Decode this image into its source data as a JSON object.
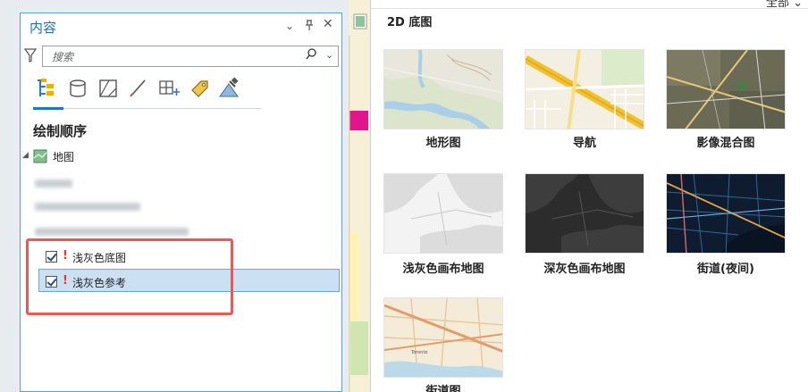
{
  "contents": {
    "title": "内容",
    "header_controls": {
      "menu": "⌄",
      "pin": "ᵍ",
      "close": "✕"
    },
    "search_placeholder": "搜索",
    "section_title": "绘制顺序",
    "map_node": "地图",
    "layers": [
      {
        "label": "浅灰色底图",
        "checked": true
      },
      {
        "label": "浅灰色参考",
        "checked": true
      }
    ]
  },
  "gallery": {
    "title": "2D 底图",
    "top_right_label": "全部 ⌄",
    "items": [
      {
        "label": "地形图"
      },
      {
        "label": "导航"
      },
      {
        "label": "影像混合图"
      },
      {
        "label": "浅灰色画布地图"
      },
      {
        "label": "深灰色画布地图"
      },
      {
        "label": "街道(夜间)"
      },
      {
        "label": "街道图"
      }
    ]
  },
  "colors": {
    "accent": "#1b6fb8",
    "selection": "#cce0f4",
    "highlight_box": "#e85a55",
    "warning": "#e03a2a"
  }
}
